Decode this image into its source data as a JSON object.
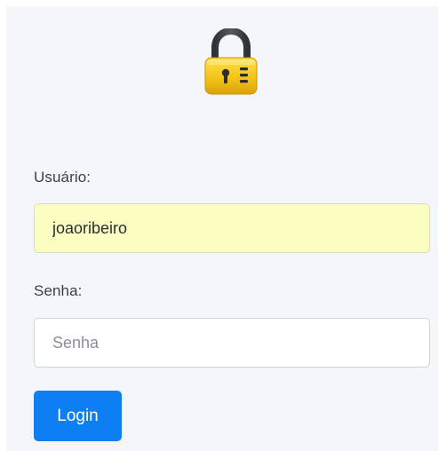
{
  "form": {
    "username": {
      "label": "Usuário:",
      "value": "joaoribeiro"
    },
    "password": {
      "label": "Senha:",
      "value": "",
      "placeholder": "Senha"
    },
    "login_label": "Login"
  },
  "icons": {
    "lock": "lock-icon"
  },
  "colors": {
    "panel_background": "#f4f6f9",
    "autofill_background": "#fbfcc0",
    "primary_button": "#0d7ff2",
    "lock_body": "#f2c417",
    "lock_shackle": "#3b3f43"
  }
}
